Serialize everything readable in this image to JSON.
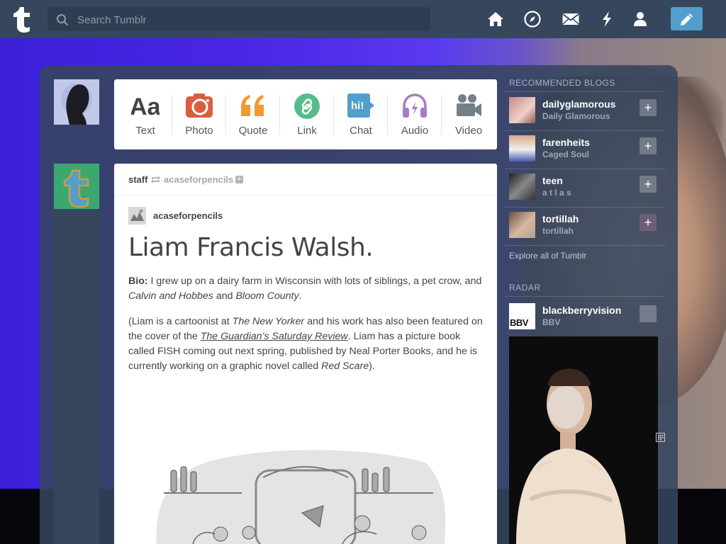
{
  "topbar": {
    "search_placeholder": "Search Tumblr",
    "icons": [
      "tumblr-logo-icon",
      "search-icon",
      "home-icon",
      "explore-compass-icon",
      "inbox-mail-icon",
      "activity-bolt-icon",
      "account-person-icon",
      "compose-pencil-icon"
    ],
    "accent": "#36465d",
    "compose_color": "#529ecc"
  },
  "post_types": [
    {
      "label": "Text",
      "icon": "text-aa-icon",
      "color": "#444444"
    },
    {
      "label": "Photo",
      "icon": "camera-icon",
      "color": "#d95e40"
    },
    {
      "label": "Quote",
      "icon": "quote-icon",
      "color": "#f2992e"
    },
    {
      "label": "Link",
      "icon": "link-icon",
      "color": "#56bc8a"
    },
    {
      "label": "Chat",
      "icon": "chat-bubble-icon",
      "color": "#529ecc"
    },
    {
      "label": "Audio",
      "icon": "headphones-icon",
      "color": "#a77dc2"
    },
    {
      "label": "Video",
      "icon": "video-camera-icon",
      "color": "#748089"
    }
  ],
  "post": {
    "blog": "staff",
    "reblogged_from": "acaseforpencils",
    "reblog_author": "acaseforpencils",
    "title": "Liam Francis Walsh.",
    "bio_label": "Bio:",
    "bio_text_1": " I grew up on a dairy farm in Wisconsin with lots of siblings, a pet crow, and ",
    "bio_em_1": "Calvin and Hobbes",
    "bio_text_2": " and ",
    "bio_em_2": "Bloom County",
    "bio_text_3": ".",
    "p2_text_1": "(Liam is a cartoonist at ",
    "p2_em_1": "The New Yorker",
    "p2_text_2": " and his work has also been featured on the cover of the ",
    "p2_link": "The Guardian’s Saturday Review",
    "p2_text_3": ". Liam has a picture book called FISH coming out next spring, published by Neal Porter Books, and he is currently working on a graphic novel called ",
    "p2_em_2": "Red Scare",
    "p2_text_4": ")."
  },
  "sidebar": {
    "recommended_title": "RECOMMENDED BLOGS",
    "blogs": [
      {
        "name": "dailyglamorous",
        "title": "Daily Glamorous"
      },
      {
        "name": "farenheits",
        "title": "Caged Soul"
      },
      {
        "name": "teen",
        "title": "a t l a s"
      },
      {
        "name": "tortillah",
        "title": "tortillah"
      }
    ],
    "explore_label": "Explore all of Tumblr",
    "radar_title": "RADAR",
    "radar_blog": {
      "name": "blackberryvision",
      "title": "BBV",
      "avatar_text": "BBV"
    }
  }
}
